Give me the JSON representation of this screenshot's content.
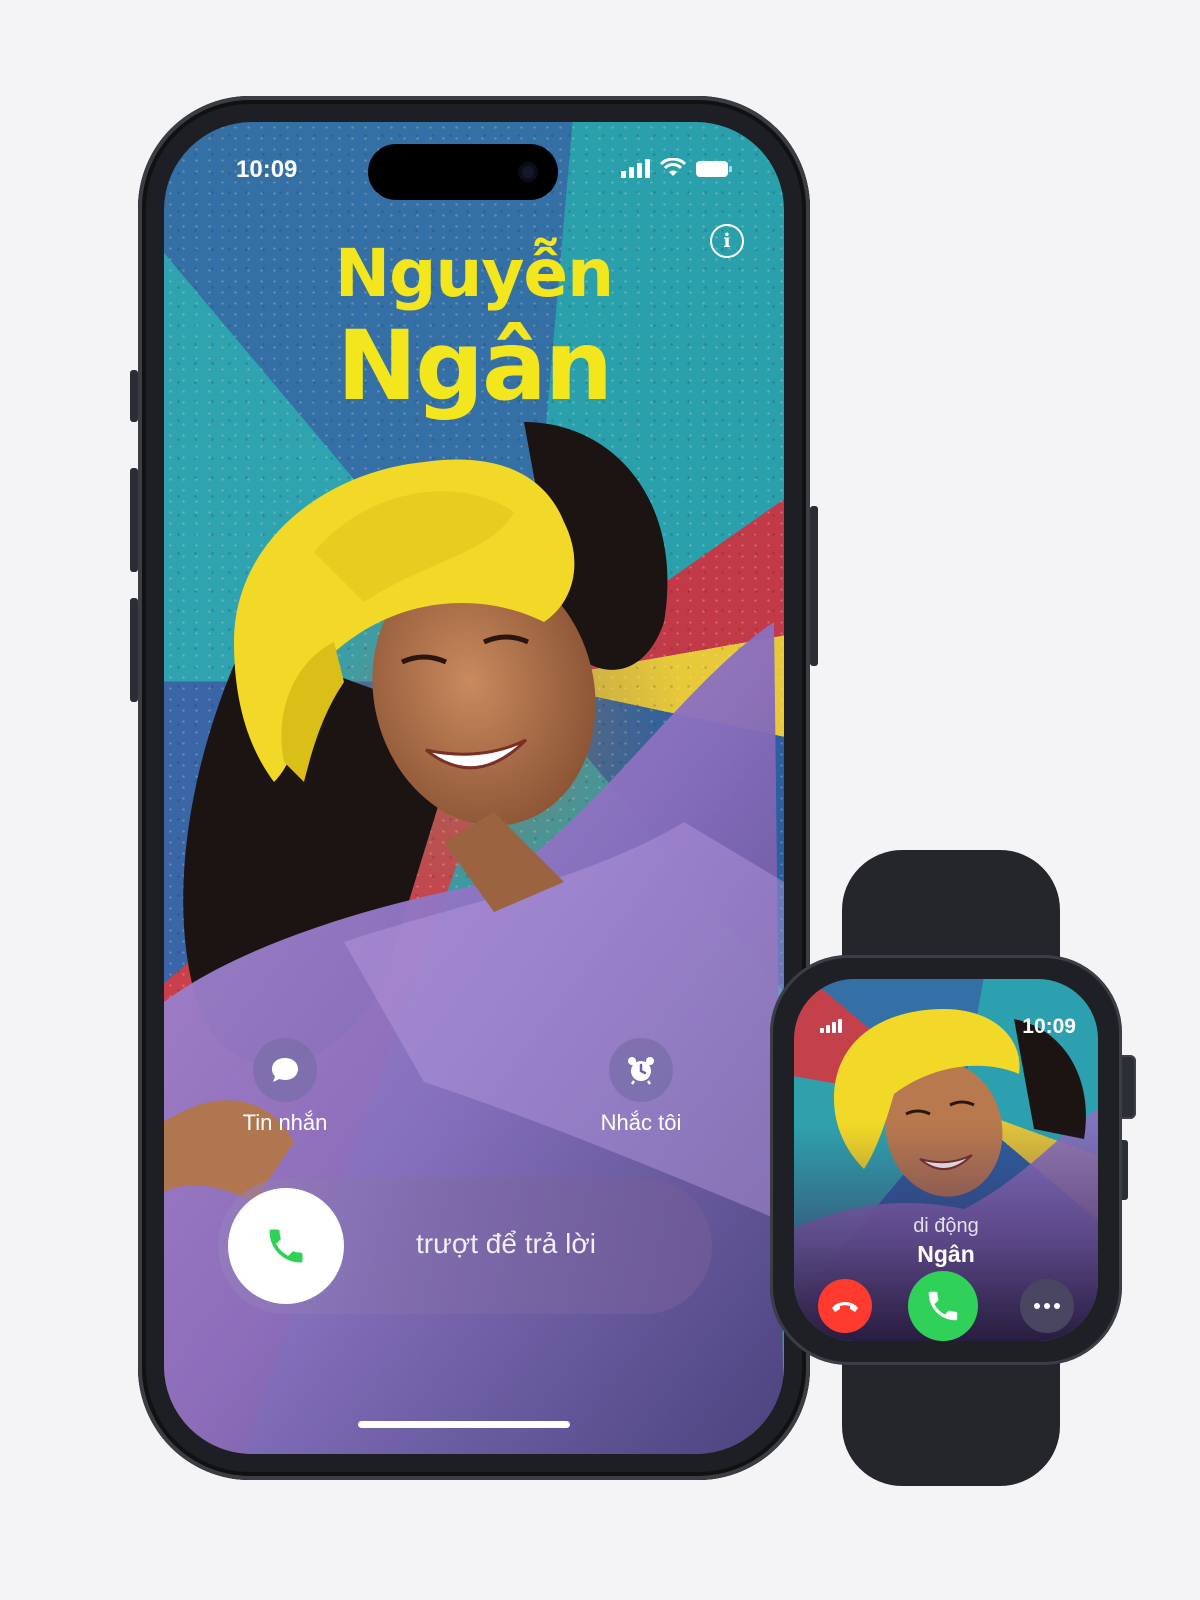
{
  "phone": {
    "status": {
      "time": "10:09"
    },
    "contact": {
      "first_name": "Nguyễn",
      "last_name": "Ngân"
    },
    "actions": [
      {
        "label": "Tin nhắn",
        "icon": "message-bubble-icon"
      },
      {
        "label": "Nhắc tôi",
        "icon": "alarm-clock-icon"
      }
    ],
    "slider": {
      "label": "trượt để trả lời",
      "icon": "phone-icon"
    },
    "info_icon": "info-icon"
  },
  "watch": {
    "status": {
      "time": "10:09"
    },
    "caller_type": "di động",
    "caller_name": "Ngân",
    "buttons": [
      {
        "name": "decline",
        "icon": "phone-down-icon",
        "color": "#ff3b30"
      },
      {
        "name": "accept",
        "icon": "phone-icon",
        "color": "#30d158"
      },
      {
        "name": "more",
        "icon": "ellipsis-icon",
        "color": "#4a4560"
      }
    ]
  },
  "colors": {
    "name_yellow": "#f4e61c",
    "accept_green": "#30d158",
    "decline_red": "#ff3b30"
  }
}
